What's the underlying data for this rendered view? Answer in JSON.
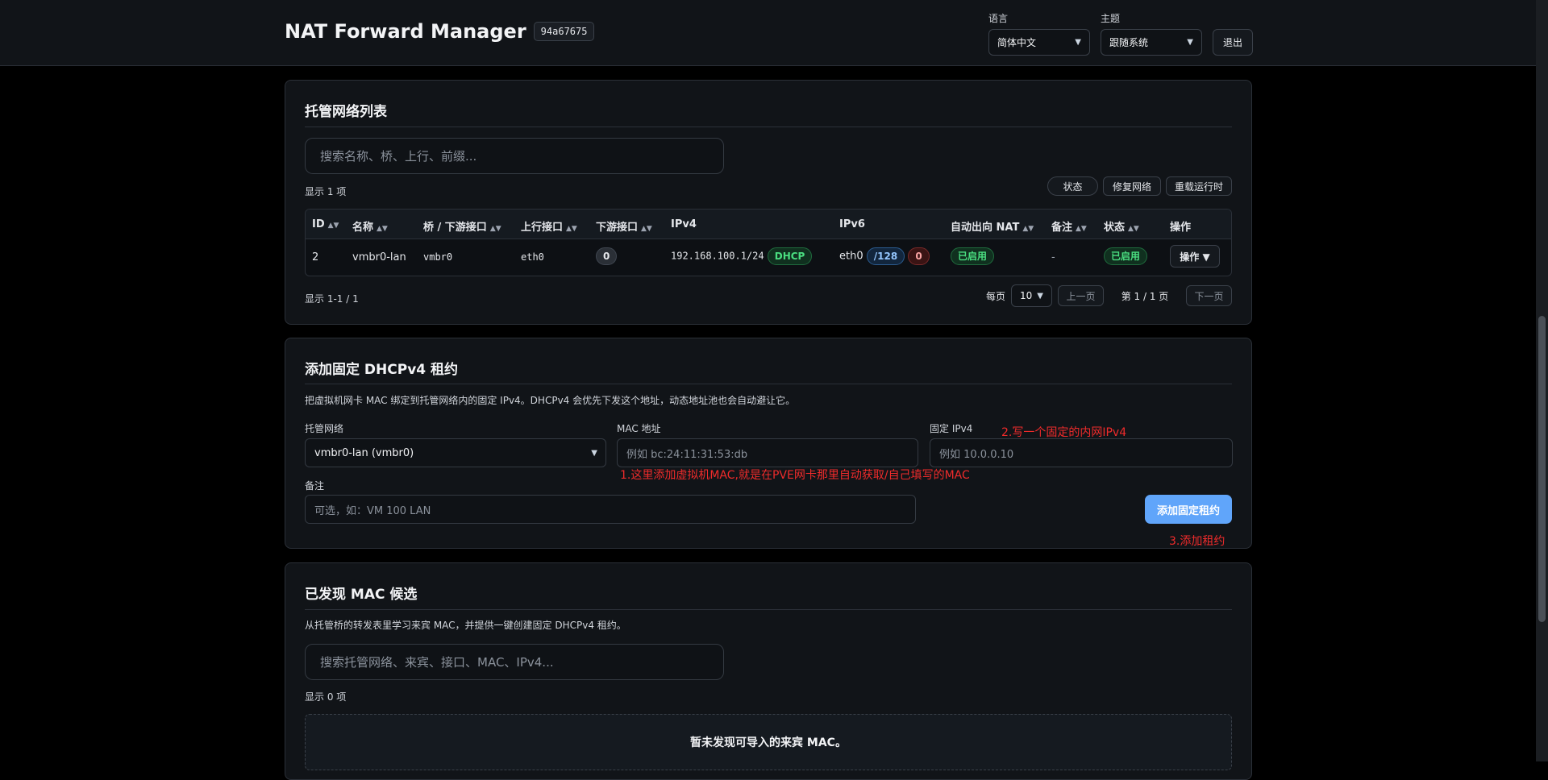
{
  "header": {
    "title": "NAT Forward Manager",
    "build": "94a67675",
    "language_label": "语言",
    "language_value": "简体中文",
    "theme_label": "主题",
    "theme_value": "跟随系统",
    "logout_label": "退出"
  },
  "networks": {
    "title": "托管网络列表",
    "search_placeholder": "搜索名称、桥、上行、前缀...",
    "count": "显示 1 项",
    "actions": [
      "状态",
      "修复网络",
      "重载运行时"
    ],
    "columns": [
      "ID",
      "名称",
      "桥 / 下游接口",
      "上行接口",
      "下游接口",
      "IPv4",
      "IPv6",
      "自动出向 NAT",
      "备注",
      "状态",
      "操作"
    ],
    "row": {
      "id": "2",
      "name": "vmbr0-lan",
      "bridge": "vmbr0",
      "uplink": "eth0",
      "downstream_count": "0",
      "ipv4": "192.168.100.1/24",
      "ipv4_mode": "DHCP",
      "ipv6_iface": "eth0",
      "ipv6_prefix": "/128",
      "ipv6_count": "0",
      "auto_nat": "已启用",
      "note": "-",
      "status": "已启用",
      "action": "操作 ▼"
    },
    "range_text": "显示 1-1 / 1",
    "per_page_label": "每页",
    "per_page_value": "10",
    "prev_label": "上一页",
    "page_text": "第 1 / 1 页",
    "next_label": "下一页"
  },
  "lease": {
    "title": "添加固定 DHCPv4 租约",
    "description": "把虚拟机网卡 MAC 绑定到托管网络内的固定 IPv4。DHCPv4 会优先下发这个地址，动态地址池也会自动避让它。",
    "network_label": "托管网络",
    "network_value": "vmbr0-lan (vmbr0)",
    "mac_label": "MAC 地址",
    "mac_placeholder": "例如 bc:24:11:31:53:db",
    "ip_label": "固定 IPv4",
    "ip_placeholder": "例如 10.0.0.10",
    "note_label": "备注",
    "note_placeholder": "可选，如：VM 100 LAN",
    "submit_label": "添加固定租约",
    "annotation_1": "1.这里添加虚拟机MAC,就是在PVE网卡那里自动获取/自己填写的MAC",
    "annotation_2": "2.写一个固定的内网IPv4",
    "annotation_3": "3.添加租约"
  },
  "mac": {
    "title": "已发现 MAC 候选",
    "description": "从托管桥的转发表里学习来宾 MAC，并提供一键创建固定 DHCPv4 租约。",
    "search_placeholder": "搜索托管网络、来宾、接口、MAC、IPv4...",
    "count": "显示 0 项",
    "empty_text": "暂未发现可导入的来宾 MAC。"
  }
}
